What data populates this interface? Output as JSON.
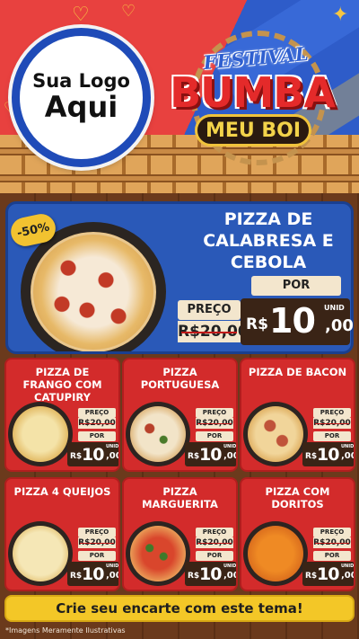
{
  "header": {
    "logo_line1": "Sua Logo",
    "logo_line2": "Aqui",
    "title_festival": "FESTIVAL",
    "title_bumba": "BUMBA",
    "title_meuboi": "MEU BOI"
  },
  "featured": {
    "discount_badge": "-50%",
    "title_line1": "PIZZA DE",
    "title_line2": "CALABRESA E",
    "title_line3": "CEBOLA",
    "preco_label": "PREÇO",
    "old_price": "R$20,00",
    "por_label": "POR",
    "currency": "R$",
    "price_int": "10",
    "price_cents": ",00",
    "unid_label": "UNID"
  },
  "cards": [
    {
      "title": "PIZZA DE FRANGO COM CATUPIRY",
      "preco_label": "PREÇO",
      "old_price": "R$20,00",
      "por_label": "POR",
      "currency": "R$",
      "price_int": "10",
      "price_cents": ",00",
      "unid_label": "UNID"
    },
    {
      "title": "PIZZA PORTUGUESA",
      "preco_label": "PREÇO",
      "old_price": "R$20,00",
      "por_label": "POR",
      "currency": "R$",
      "price_int": "10",
      "price_cents": ",00",
      "unid_label": "UNID"
    },
    {
      "title": "PIZZA DE BACON",
      "preco_label": "PREÇO",
      "old_price": "R$20,00",
      "por_label": "POR",
      "currency": "R$",
      "price_int": "10",
      "price_cents": ",00",
      "unid_label": "UNID"
    },
    {
      "title": "PIZZA 4 QUEIJOS",
      "preco_label": "PREÇO",
      "old_price": "R$20,00",
      "por_label": "POR",
      "currency": "R$",
      "price_int": "10",
      "price_cents": ",00",
      "unid_label": "UNID"
    },
    {
      "title": "PIZZA MARGUERITA",
      "preco_label": "PREÇO",
      "old_price": "R$20,00",
      "por_label": "POR",
      "currency": "R$",
      "price_int": "10",
      "price_cents": ",00",
      "unid_label": "UNID"
    },
    {
      "title": "PIZZA COM DORITOS",
      "preco_label": "PREÇO",
      "old_price": "R$20,00",
      "por_label": "POR",
      "currency": "R$",
      "price_int": "10",
      "price_cents": ",00",
      "unid_label": "UNID"
    }
  ],
  "footer": {
    "cta": "Crie seu encarte com este tema!",
    "disclaimer": "*Imagens Meramente Ilustrativas"
  },
  "colors": {
    "header_red": "#e8413f",
    "header_blue": "#2e5cc9",
    "card_red": "#d32b2b",
    "featured_blue": "#2a59b8",
    "cta_yellow": "#f3c727",
    "price_dark": "#3a2416",
    "label_cream": "#f3e6cd"
  }
}
